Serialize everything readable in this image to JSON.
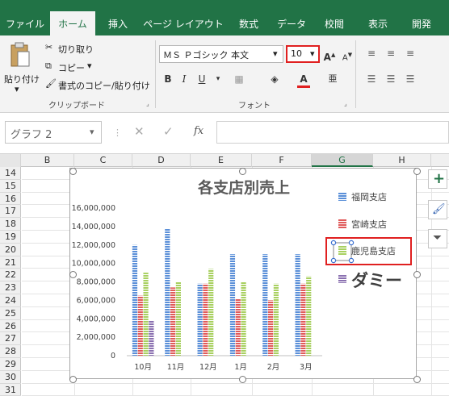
{
  "tabs": [
    {
      "label": "ファイル",
      "active": false
    },
    {
      "label": "ホーム",
      "active": true
    },
    {
      "label": "挿入",
      "active": false
    },
    {
      "label": "ページ レイアウト",
      "active": false
    },
    {
      "label": "数式",
      "active": false
    },
    {
      "label": "データ",
      "active": false
    },
    {
      "label": "校閲",
      "active": false
    },
    {
      "label": "表示",
      "active": false
    },
    {
      "label": "開発",
      "active": false
    }
  ],
  "clipboard": {
    "paste": "貼り付け",
    "cut": "切り取り",
    "copy": "コピー",
    "format_painter": "書式のコピー/貼り付け",
    "group": "クリップボード"
  },
  "font": {
    "name": "ＭＳ Ｐゴシック 本文",
    "size": "10",
    "group": "フォント",
    "bold": "B",
    "italic": "I",
    "underline": "U"
  },
  "namebox": "グラフ 2",
  "formula": {
    "fx": "fx",
    "value": ""
  },
  "columns": [
    "B",
    "C",
    "D",
    "E",
    "F",
    "G",
    "H"
  ],
  "rows": [
    "14",
    "15",
    "16",
    "17",
    "18",
    "19",
    "20",
    "21",
    "22",
    "23",
    "24",
    "25",
    "26",
    "27",
    "28",
    "29",
    "30",
    "31"
  ],
  "colors": {
    "ribbon": "#217346",
    "accent_red": "#e02020"
  },
  "chart_data": {
    "type": "bar",
    "title": "各支店別売上",
    "categories": [
      "10月",
      "11月",
      "12月",
      "1月",
      "2月",
      "3月"
    ],
    "ylim": [
      0,
      16000000
    ],
    "yticks": [
      "16,000,000",
      "14,000,000",
      "12,000,000",
      "10,000,000",
      "8,000,000",
      "6,000,000",
      "4,000,000",
      "2,000,000",
      "0"
    ],
    "series": [
      {
        "name": "福岡支店",
        "color": "#5a8fd8",
        "values": [
          12000000,
          13800000,
          7800000,
          11000000,
          11000000,
          11000000
        ]
      },
      {
        "name": "宮崎支店",
        "color": "#e05a5a",
        "values": [
          6500000,
          7400000,
          7800000,
          6200000,
          6000000,
          7800000
        ]
      },
      {
        "name": "鹿児島支店",
        "color": "#a8d060",
        "values": [
          9000000,
          8000000,
          9400000,
          8000000,
          7800000,
          8600000
        ]
      },
      {
        "name": "ダミー",
        "color": "#8a70b0",
        "values": [
          3800000,
          0,
          0,
          0,
          0,
          0
        ]
      }
    ],
    "legend": "right",
    "grid": false
  }
}
